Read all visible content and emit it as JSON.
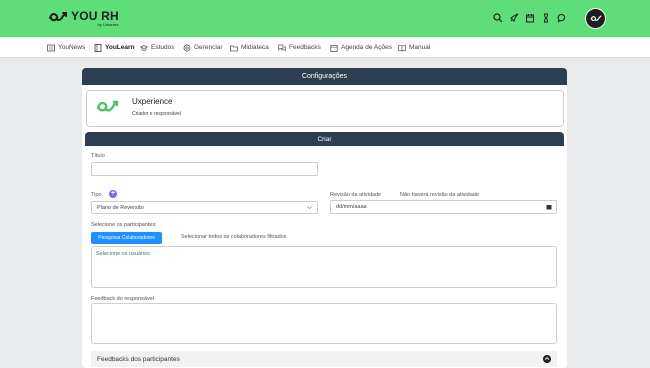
{
  "header": {
    "brand": "YOU RH",
    "brand_sub": "by Umantec",
    "icons": [
      "search-icon",
      "rocket-icon",
      "calendar-icon",
      "hourglass-icon",
      "chat-icon"
    ]
  },
  "nav": {
    "items": [
      {
        "label": "YouNews",
        "icon": "newspaper-icon"
      },
      {
        "label": "YouLearn",
        "icon": "book-icon",
        "active": true
      },
      {
        "label": "Estudos",
        "icon": "graduation-cap-icon"
      },
      {
        "label": "Gerenciar",
        "icon": "settings-icon"
      },
      {
        "label": "Midiateca",
        "icon": "folder-icon"
      },
      {
        "label": "Feedbacks",
        "icon": "comments-icon"
      },
      {
        "label": "Agenda de Ações",
        "icon": "calendar-icon"
      },
      {
        "label": "Manual",
        "icon": "open-book-icon"
      }
    ]
  },
  "panel": {
    "title": "Configurações",
    "card": {
      "title": "Uxperience",
      "subtitle": "Criador e responsável"
    }
  },
  "form": {
    "title": "Criar",
    "titulo_label": "Título",
    "titulo_value": "",
    "tipo_label": "Tipo",
    "tipo_value": "Plano de Reversão",
    "revisao_label": "Revisão da atividade",
    "revisao_note": "Não haverá revisão da atividade",
    "revisao_placeholder": "dd/mm/aaaa",
    "participantes_label": "Selecione os participantes:",
    "pesquisar_button": "Pesquisar Colaboradores",
    "selecionar_todos": "Selecionar todos os colaboradores filtrados",
    "usuarios_placeholder": "Selecione os usuários",
    "feedback_label": "Feedback do responsável",
    "feedbacks_participantes": "Feedbacks dos participantes"
  },
  "colors": {
    "topbar": "#5fdd78",
    "panel_header": "#2c3e4f",
    "primary_button": "#1e90ff",
    "add_icon": "#7b68ee"
  }
}
